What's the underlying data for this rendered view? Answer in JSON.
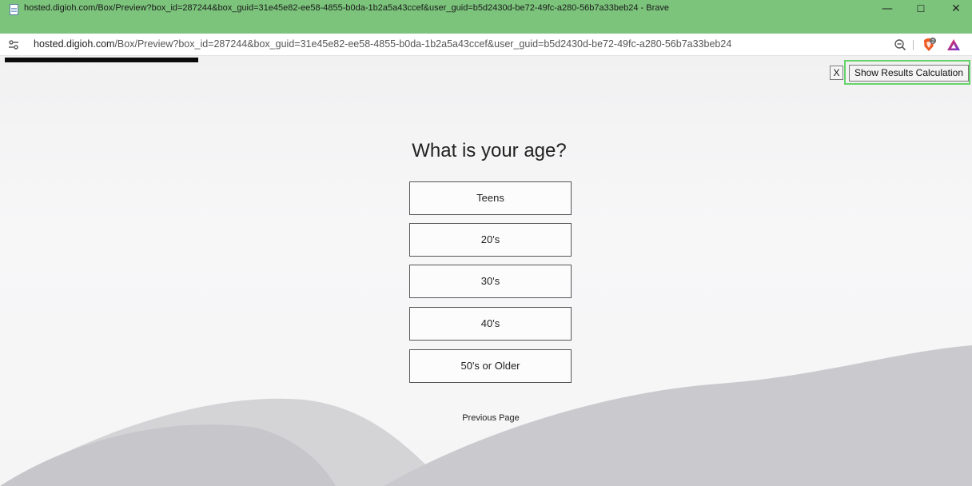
{
  "browser": {
    "window_title": "hosted.digioh.com/Box/Preview?box_id=287244&box_guid=31e45e82-ee58-4855-b0da-1b2a5a43ccef&user_guid=b5d2430d-be72-49fc-a280-56b7a33beb24 - Brave",
    "url_host": "hosted.digioh.com",
    "url_path": "/Box/Preview?box_id=287244&box_guid=31e45e82-ee58-4855-b0da-1b2a5a43ccef&user_guid=b5d2430d-be72-49fc-a280-56b7a33beb24",
    "minimize_glyph": "—",
    "maximize_glyph": "☐",
    "close_glyph": "✕",
    "icons": [
      "page-icon",
      "site-settings-icon",
      "zoom-out-icon",
      "brave-shields-icon",
      "brave-rewards-icon"
    ],
    "brave_badge": "2",
    "accent_color": "#7cc47c"
  },
  "preview": {
    "close_label": "X",
    "show_results_label": "Show Results Calculation",
    "highlight_color": "#66d36a"
  },
  "quiz": {
    "question": "What is your age?",
    "options": [
      "Teens",
      "20's",
      "30's",
      "40's",
      "50's or Older"
    ],
    "previous_label": "Previous Page"
  }
}
